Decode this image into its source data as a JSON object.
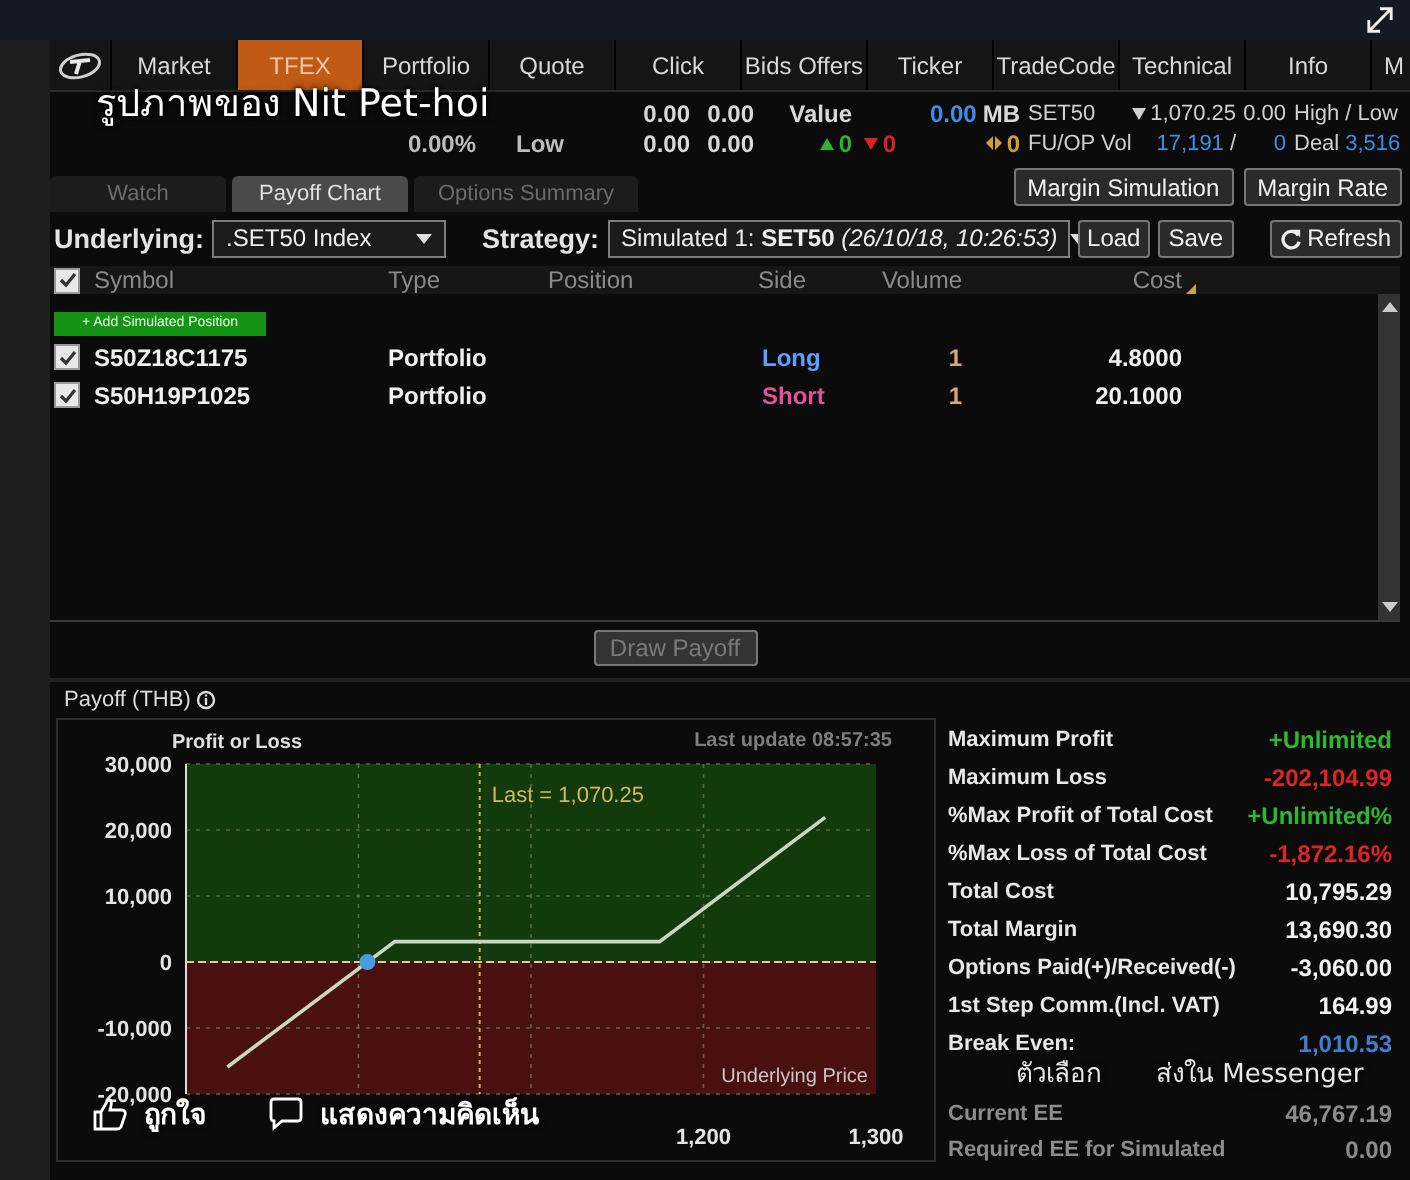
{
  "nav": {
    "items": [
      {
        "label": "Market",
        "selected": false
      },
      {
        "label": "TFEX",
        "selected": true
      },
      {
        "label": "Portfolio",
        "selected": false
      },
      {
        "label": "Quote",
        "selected": false
      },
      {
        "label": "Click",
        "selected": false
      },
      {
        "label": "Bids Offers",
        "selected": false
      },
      {
        "label": "Ticker",
        "selected": false
      },
      {
        "label": "TradeCode",
        "selected": false
      },
      {
        "label": "Technical",
        "selected": false
      },
      {
        "label": "Info",
        "selected": false
      },
      {
        "label": "M",
        "selected": false
      }
    ]
  },
  "quote_strip": {
    "columns": [
      {
        "bottom": [
          {
            "text": "0.00%",
            "kind": "muted"
          }
        ]
      },
      {
        "bottom": [
          {
            "text": "Low",
            "kind": "muted"
          }
        ]
      },
      {
        "top": [
          {
            "text": "0.00",
            "kind": "plain"
          }
        ],
        "bottom": [
          {
            "text": "0.00",
            "kind": "plain"
          }
        ]
      },
      {
        "top": [
          {
            "text": "0.00",
            "kind": "plain"
          }
        ],
        "bottom": [
          {
            "text": "0.00",
            "kind": "plain"
          }
        ]
      },
      {
        "top": [
          {
            "text": "Value",
            "kind": "plain"
          }
        ],
        "bottom": [
          {
            "text": "0",
            "kind": "up"
          }
        ]
      },
      {
        "bottom": [
          {
            "text": "0",
            "kind": "down"
          }
        ]
      },
      {
        "top": [
          {
            "text": "0.00",
            "kind": "price"
          },
          {
            "text": "MB",
            "kind": "plain"
          }
        ],
        "bottom": [
          {
            "text": "0",
            "kind": "flat"
          }
        ]
      },
      {
        "top": [
          {
            "text": "SET50",
            "kind": "label"
          }
        ],
        "bottom": [
          {
            "text": "FU/OP Vol",
            "kind": "label"
          }
        ]
      },
      {
        "top": [
          {
            "text": "1,070.25",
            "kind": "fall"
          }
        ],
        "bottom": [
          {
            "text": "17,191",
            "kind": "price"
          },
          {
            "text": "/",
            "kind": "label"
          }
        ]
      },
      {
        "top": [
          {
            "text": "0.00",
            "kind": "label"
          }
        ],
        "bottom": [
          {
            "text": "0",
            "kind": "price"
          }
        ]
      },
      {
        "top": [
          {
            "text": "High / Low",
            "kind": "label"
          }
        ],
        "bottom": [
          {
            "text": "Deal",
            "kind": "label"
          },
          {
            "text": "3,516",
            "kind": "price"
          }
        ]
      }
    ]
  },
  "tabs": [
    {
      "label": "Watch",
      "selected": false
    },
    {
      "label": "Payoff Chart",
      "selected": true
    },
    {
      "label": "Options Summary",
      "selected": false
    }
  ],
  "top_buttons": [
    "Margin Simulation",
    "Margin Rate"
  ],
  "controls": {
    "underlying_label": "Underlying:",
    "underlying_value": ".SET50 Index",
    "strategy_label": "Strategy:",
    "strategy_value": "Simulated 1: **SET50** *(26/10/18, 10:26:53)*",
    "load": "Load",
    "save": "Save",
    "refresh": "Refresh"
  },
  "table": {
    "all_checked": true,
    "columns": [
      "Symbol",
      "Type",
      "Position",
      "Side",
      "Volume",
      "Cost"
    ],
    "add_button": "+ Add Simulated Position",
    "rows": [
      {
        "checked": true,
        "symbol": "S50Z18C1175",
        "type": "Portfolio",
        "side": "Long",
        "kind": "long",
        "volume": "1",
        "cost": "4.8000"
      },
      {
        "checked": true,
        "symbol": "S50H19P1025",
        "type": "Portfolio",
        "side": "Short",
        "kind": "short",
        "volume": "1",
        "cost": "20.1000"
      }
    ]
  },
  "draw_button": {
    "label": "Draw Payoff",
    "disabled": true
  },
  "payoff": {
    "title": "Payoff (THB)",
    "last_update": "Last update 08:57:35",
    "chart_data": {
      "type": "line",
      "ylabel": "Profit or Loss",
      "xlabel": "Underlying Price",
      "x": [
        924,
        1021,
        1174.5,
        1270.5
      ],
      "series": [
        {
          "color": "#c8d8c0",
          "values": [
            -15900,
            3100,
            3100,
            21900
          ]
        }
      ],
      "xlim": [
        900,
        1300
      ],
      "ylim": [
        -20000,
        30000
      ],
      "grid": true,
      "xticks": [
        {
          "value": 1200,
          "label": "1,200"
        },
        {
          "value": 1300,
          "label": "1,300"
        }
      ],
      "yticks": [
        {
          "value": 30000,
          "label": "30,000"
        },
        {
          "value": 20000,
          "label": "20,000"
        },
        {
          "value": 10000,
          "label": "10,000"
        },
        {
          "value": 0,
          "label": "0"
        },
        {
          "value": -10000,
          "label": "-10,000"
        },
        {
          "value": -20000,
          "label": "-20,000"
        }
      ],
      "bands": [
        {
          "axis": "y",
          "from": 0,
          "to": 30000,
          "color": "#123a0c"
        },
        {
          "axis": "y",
          "from": -20000,
          "to": 0,
          "color": "#4a0f0f"
        }
      ],
      "ref_lines": [
        {
          "axis": "y",
          "value": 0,
          "color": "#d8c9a0"
        },
        {
          "axis": "x",
          "value": 1070.25,
          "label": "Last = 1,070.25",
          "color": "#c9b060"
        }
      ]
    },
    "stats": [
      {
        "label": "Maximum Profit",
        "value": "+Unlimited",
        "kind": "gain"
      },
      {
        "label": "Maximum Loss",
        "value": "-202,104.99",
        "kind": "loss"
      },
      {
        "label": "%Max Profit of Total Cost",
        "value": "+Unlimited%",
        "kind": "gain"
      },
      {
        "label": "%Max Loss of Total Cost",
        "value": "-1,872.16%",
        "kind": "loss"
      },
      {
        "label": "Total Cost",
        "value": "10,795.29",
        "kind": "plain"
      },
      {
        "label": "Total Margin",
        "value": "13,690.30",
        "kind": "plain"
      },
      {
        "label": "Options Paid(+)/Received(-)",
        "value": "-3,060.00",
        "kind": "plain"
      },
      {
        "label": "1st Step Comm.(Incl. VAT)",
        "value": "164.99",
        "kind": "plain"
      },
      {
        "label": "Break Even:",
        "value": "1,010.53",
        "kind": "price"
      }
    ],
    "ee_stats": [
      {
        "label": "Current EE",
        "value": "46,767.19",
        "kind": "muted"
      },
      {
        "label": "Required EE for Simulated",
        "value": "0.00",
        "kind": "muted"
      }
    ]
  },
  "photo_overlay": {
    "title": "รูปภาพของ Nit Pet-hoi",
    "like": "ถูกใจ",
    "comment": "แสดงความคิดเห็น",
    "options": "ตัวเลือก",
    "send": "ส่งใน Messenger"
  }
}
